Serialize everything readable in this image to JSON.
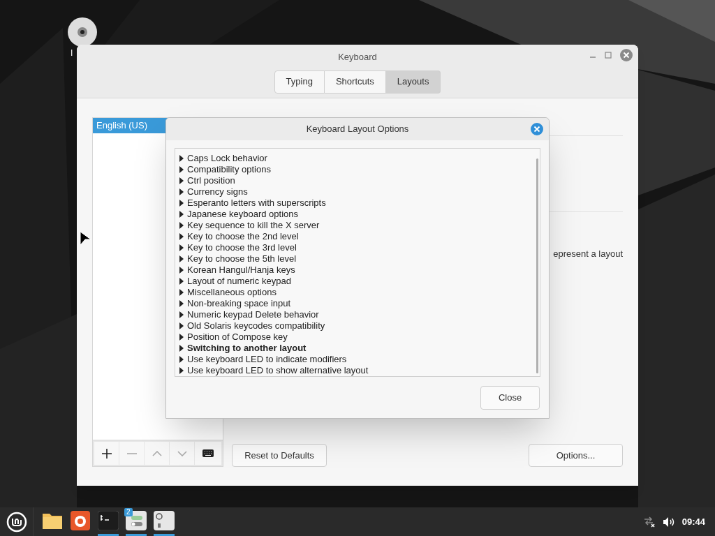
{
  "desktop": {
    "icons": [
      {
        "label": "I"
      }
    ]
  },
  "window": {
    "title": "Keyboard",
    "tabs": [
      {
        "label": "Typing",
        "selected": false
      },
      {
        "label": "Shortcuts",
        "selected": false
      },
      {
        "label": "Layouts",
        "selected": true
      }
    ],
    "layouts": [
      {
        "name": "English (US)",
        "selected": true
      }
    ],
    "description": "epresent a layout",
    "reset_button": "Reset to Defaults",
    "options_button": "Options..."
  },
  "dialog": {
    "title": "Keyboard Layout Options",
    "items": [
      {
        "label": "Caps Lock behavior",
        "highlighted": false
      },
      {
        "label": "Compatibility options",
        "highlighted": false
      },
      {
        "label": "Ctrl position",
        "highlighted": false
      },
      {
        "label": "Currency signs",
        "highlighted": false
      },
      {
        "label": "Esperanto letters with superscripts",
        "highlighted": false
      },
      {
        "label": "Japanese keyboard options",
        "highlighted": false
      },
      {
        "label": "Key sequence to kill the X server",
        "highlighted": false
      },
      {
        "label": "Key to choose the 2nd level",
        "highlighted": false
      },
      {
        "label": "Key to choose the 3rd level",
        "highlighted": false
      },
      {
        "label": "Key to choose the 5th level",
        "highlighted": false
      },
      {
        "label": "Korean Hangul/Hanja keys",
        "highlighted": false
      },
      {
        "label": "Layout of numeric keypad",
        "highlighted": false
      },
      {
        "label": "Miscellaneous options",
        "highlighted": false
      },
      {
        "label": "Non-breaking space input",
        "highlighted": false
      },
      {
        "label": "Numeric keypad Delete behavior",
        "highlighted": false
      },
      {
        "label": "Old Solaris keycodes compatibility",
        "highlighted": false
      },
      {
        "label": "Position of Compose key",
        "highlighted": false
      },
      {
        "label": "Switching to another layout",
        "highlighted": true
      },
      {
        "label": "Use keyboard LED to indicate modifiers",
        "highlighted": false
      },
      {
        "label": "Use keyboard LED to show alternative layout",
        "highlighted": false
      }
    ],
    "close_button": "Close"
  },
  "taskbar": {
    "apps": [
      {
        "kind": "folder",
        "running": false
      },
      {
        "kind": "browser",
        "running": false
      },
      {
        "kind": "terminal",
        "running": true
      },
      {
        "kind": "settings",
        "running": true,
        "badge": "2"
      },
      {
        "kind": "keyboard",
        "running": true
      }
    ],
    "clock": "09:44"
  }
}
